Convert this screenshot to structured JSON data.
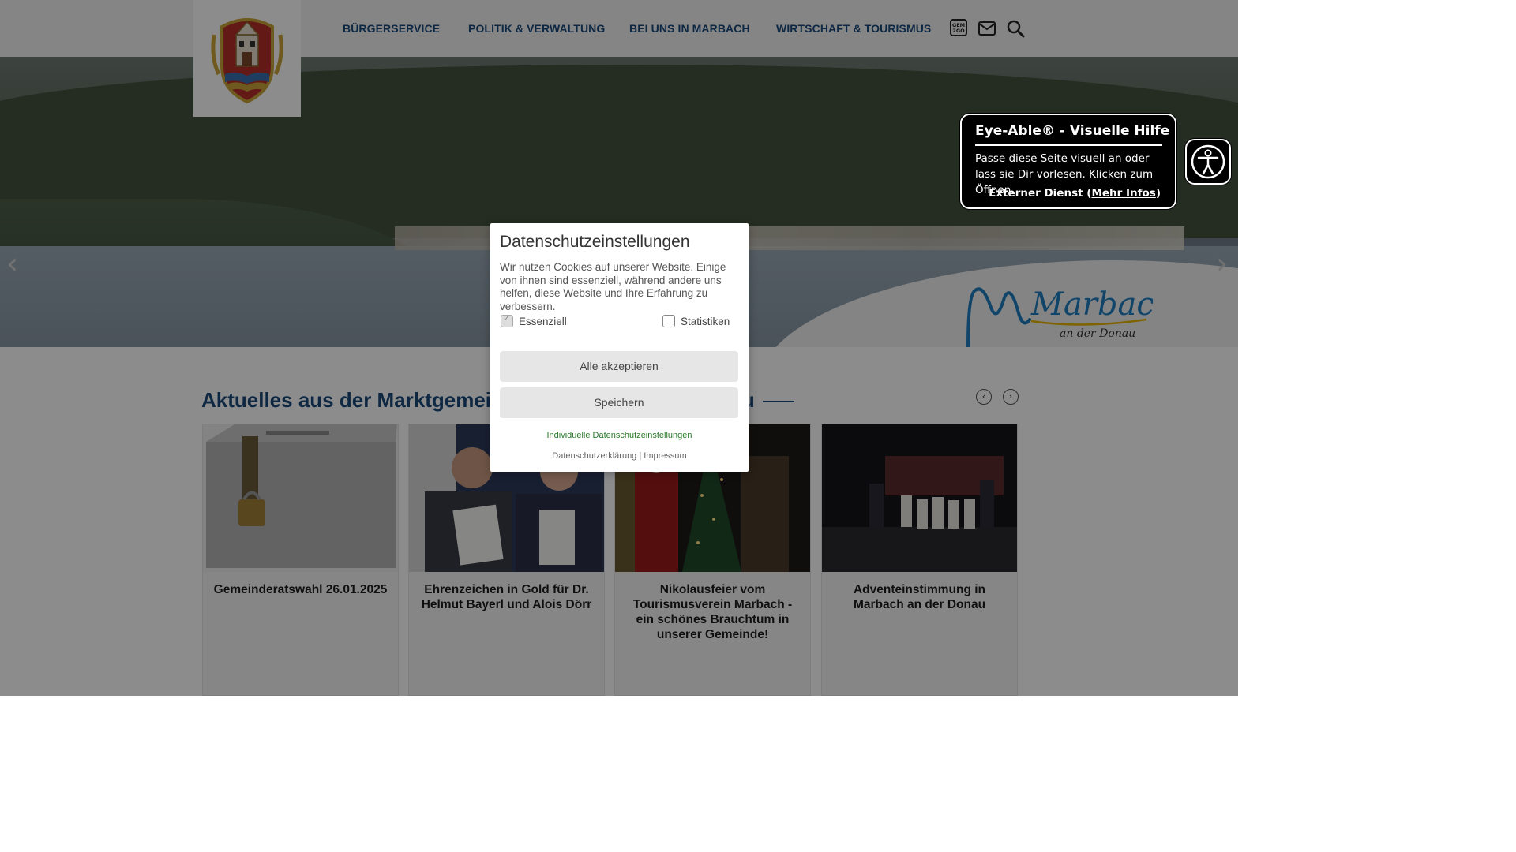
{
  "nav": {
    "items": [
      {
        "label": "BÜRGERSERVICE"
      },
      {
        "label": "POLITIK & VERWALTUNG"
      },
      {
        "label": "BEI UNS IN MARBACH"
      },
      {
        "label": "WIRTSCHAFT & TOURISMUS"
      }
    ],
    "icons": [
      "gem2go-icon",
      "mail-icon",
      "search-icon"
    ],
    "gem_label_top": "GEM",
    "gem_label_bottom": "2GO"
  },
  "hero": {
    "brand": "Marbach",
    "brand_sub": "an der Donau"
  },
  "news": {
    "title": "Aktuelles aus der Marktgemeinde Marbach an der Donau",
    "cards": [
      {
        "title": "Gemeinderatswahl 26.01.2025"
      },
      {
        "title": "Ehrenzeichen in Gold für Dr. Helmut Bayerl und Alois Dörr"
      },
      {
        "title": "Nikolausfeier vom Tourismusverein Marbach - ein schönes Brauchtum in unserer Gemeinde!"
      },
      {
        "title": "Adventeinstimmung in Marbach an der Donau"
      }
    ]
  },
  "eyeable": {
    "title": "Eye-Able® - Visuelle Hilfe",
    "desc": "Passe diese Seite visuell an oder lass sie Dir vorlesen. Klicken zum Öffnen.",
    "external": "Externer Dienst (",
    "more": "Mehr Infos",
    "close_paren": ")"
  },
  "cookie": {
    "title": "Datenschutzeinstellungen",
    "desc": "Wir nutzen Cookies auf unserer Website. Einige von ihnen sind essenziell, während andere uns helfen, diese Website und Ihre Erfahrung zu verbessern.",
    "essential_label": "Essenziell",
    "stats_label": "Statistiken",
    "accept_all": "Alle akzeptieren",
    "save": "Speichern",
    "individual": "Individuelle Datenschutzeinstellungen",
    "privacy": "Datenschutzerklärung",
    "separator": "|",
    "imprint": "Impressum"
  },
  "colors": {
    "nav_text": "#1a4a7a",
    "title": "#1a4a7a",
    "brand_blue": "#1e7fc0",
    "brand_yellow": "#e8b400",
    "individual_link": "#2a7a2a"
  }
}
